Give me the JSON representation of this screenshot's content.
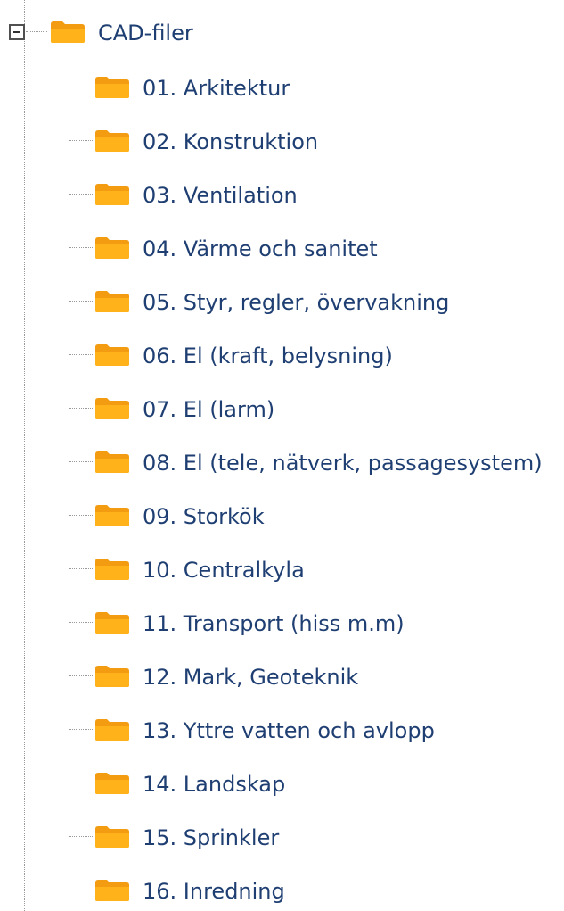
{
  "tree": {
    "root": {
      "label": "CAD-filer",
      "expanded": true,
      "icon": "folder-icon",
      "children": [
        {
          "label": "01. Arkitektur",
          "icon": "folder-icon"
        },
        {
          "label": "02. Konstruktion",
          "icon": "folder-icon"
        },
        {
          "label": "03. Ventilation",
          "icon": "folder-icon"
        },
        {
          "label": "04. Värme och sanitet",
          "icon": "folder-icon"
        },
        {
          "label": "05. Styr, regler, övervakning",
          "icon": "folder-icon"
        },
        {
          "label": "06. El (kraft, belysning)",
          "icon": "folder-icon"
        },
        {
          "label": "07. El (larm)",
          "icon": "folder-icon"
        },
        {
          "label": "08. El (tele, nätverk, passagesystem)",
          "icon": "folder-icon"
        },
        {
          "label": "09. Storkök",
          "icon": "folder-icon"
        },
        {
          "label": "10. Centralkyla",
          "icon": "folder-icon"
        },
        {
          "label": "11. Transport (hiss m.m)",
          "icon": "folder-icon"
        },
        {
          "label": "12. Mark, Geoteknik",
          "icon": "folder-icon"
        },
        {
          "label": "13. Yttre vatten och avlopp",
          "icon": "folder-icon"
        },
        {
          "label": "14. Landskap",
          "icon": "folder-icon"
        },
        {
          "label": "15. Sprinkler",
          "icon": "folder-icon"
        },
        {
          "label": "16. Inredning",
          "icon": "folder-icon"
        }
      ]
    }
  },
  "colors": {
    "text": "#1f3f73",
    "folder_front": "#ffb21a",
    "folder_back": "#f39c12",
    "guide_line": "#9a9a9a"
  }
}
